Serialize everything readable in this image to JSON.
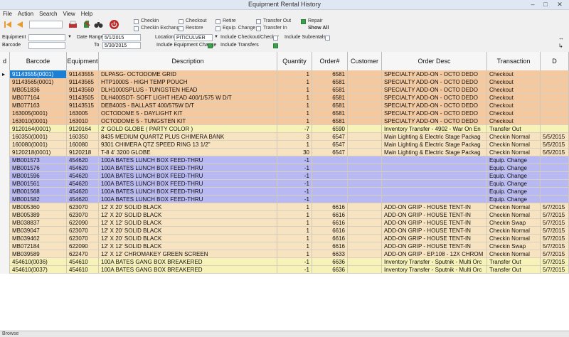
{
  "window": {
    "title": "Equipment Rental History"
  },
  "menu": [
    "File",
    "Action",
    "Search",
    "View",
    "Help"
  ],
  "filters": {
    "equipment_label": "Equipment",
    "equipment_value": "",
    "barcode_label": "Barcode",
    "barcode_value": "",
    "date_range_label": "Date Range",
    "date_from": "5/1/2015",
    "to_label": "To",
    "date_to": "5/30/2015",
    "location_label": "Location",
    "location_value": "PITICULVER",
    "include_equipment_change": "Include Equipment Change",
    "include_checkout_checker": "Include Checkout/Checker",
    "include_subrentals": "Include Subrentals",
    "include_transfers": "Include Transfers"
  },
  "trans_types": [
    {
      "label": "Checkin",
      "checked": false
    },
    {
      "label": "Checkout",
      "checked": false
    },
    {
      "label": "Retire",
      "checked": false
    },
    {
      "label": "Transfer Out",
      "checked": false
    },
    {
      "label": "Repair",
      "checked": true
    },
    {
      "label": "Checkin Exchange",
      "checked": false
    },
    {
      "label": "Restore",
      "checked": false
    },
    {
      "label": "Equip. Change",
      "checked": false
    },
    {
      "label": "Transfer In",
      "checked": false
    },
    {
      "label": "Show All",
      "checked": false
    }
  ],
  "columns": [
    "d",
    "Barcode",
    "Equipment",
    "Description",
    "Quantity",
    "Order#",
    "Customer",
    "Order Desc",
    "Transaction",
    "D"
  ],
  "colors": {
    "checkout": "#f5c9a0",
    "transfer": "#f7f2b8",
    "checkin": "#f7e3bf",
    "equipchange": "#b8b8f2",
    "selected": "#1c7fd6"
  },
  "rows": [
    {
      "barcode": "91143555(0001)",
      "equipment": "91143555",
      "description": "DLPASG- OCTODOME GRID",
      "quantity": "1",
      "order": "6581",
      "customer": "",
      "order_desc": "SPECIALTY ADD-ON - OCTO DEDO",
      "transaction": "Checkout",
      "date": "",
      "type": "checkout",
      "selected": true
    },
    {
      "barcode": "91143565(0001)",
      "equipment": "91143565",
      "description": "HTP1000S - HIGH TEMP POUCH",
      "quantity": "1",
      "order": "6581",
      "customer": "",
      "order_desc": "SPECIALTY ADD-ON - OCTO DEDO",
      "transaction": "Checkout",
      "date": "",
      "type": "checkout"
    },
    {
      "barcode": "MB051836",
      "equipment": "91143560",
      "description": "DLH1000SPLUS - TUNGSTEN HEAD",
      "quantity": "1",
      "order": "6581",
      "customer": "",
      "order_desc": "SPECIALTY ADD-ON - OCTO DEDO",
      "transaction": "Checkout",
      "date": "",
      "type": "checkout"
    },
    {
      "barcode": "MB077164",
      "equipment": "91143505",
      "description": "DLH400SDT- SOFT LIGHT HEAD 400/1/575 W D/T",
      "quantity": "1",
      "order": "6581",
      "customer": "",
      "order_desc": "SPECIALTY ADD-ON - OCTO DEDO",
      "transaction": "Checkout",
      "date": "",
      "type": "checkout"
    },
    {
      "barcode": "MB077163",
      "equipment": "91143515",
      "description": "DEB400S - BALLAST 400/575W D/T",
      "quantity": "1",
      "order": "6581",
      "customer": "",
      "order_desc": "SPECIALTY ADD-ON - OCTO DEDO",
      "transaction": "Checkout",
      "date": "",
      "type": "checkout"
    },
    {
      "barcode": "163005(0001)",
      "equipment": "163005",
      "description": "OCTODOME 5 - DAYLIGHT KIT",
      "quantity": "1",
      "order": "6581",
      "customer": "",
      "order_desc": "SPECIALTY ADD-ON - OCTO DEDO",
      "transaction": "Checkout",
      "date": "",
      "type": "checkout"
    },
    {
      "barcode": "163010(0001)",
      "equipment": "163010",
      "description": "OCTODOME 5 - TUNGSTEN KIT",
      "quantity": "1",
      "order": "6581",
      "customer": "",
      "order_desc": "SPECIALTY ADD-ON - OCTO DEDO",
      "transaction": "Checkout",
      "date": "",
      "type": "checkout"
    },
    {
      "barcode": "9120164(0001)",
      "equipment": "9120164",
      "description": "2' GOLD GLOBE ( PARTY COLOR )",
      "quantity": "-7",
      "order": "6590",
      "customer": "",
      "order_desc": "Inventory Transfer - 4902 - War On En",
      "transaction": "Transfer Out",
      "date": "",
      "type": "transfer"
    },
    {
      "barcode": "160350(0001)",
      "equipment": "160350",
      "description": "8435 MEDIUM QUARTZ PLUS CHIMERA BANK",
      "quantity": "3",
      "order": "6547",
      "customer": "",
      "order_desc": "Main Lighting & Electric Stage Packag",
      "transaction": "Checkin Normal",
      "date": "5/5/2015",
      "type": "checkin"
    },
    {
      "barcode": "160080(0001)",
      "equipment": "160080",
      "description": "9301 CHIMERA QTZ SPEED RING  13 1/2\"",
      "quantity": "1",
      "order": "6547",
      "customer": "",
      "order_desc": "Main Lighting & Electric Stage Packag",
      "transaction": "Checkin Normal",
      "date": "5/5/2015",
      "type": "checkin"
    },
    {
      "barcode": "9120218(0001)",
      "equipment": "9120218",
      "description": "T-8 4' 3200 GLOBE",
      "quantity": "30",
      "order": "6547",
      "customer": "",
      "order_desc": "Main Lighting & Electric Stage Packag",
      "transaction": "Checkin Normal",
      "date": "5/5/2015",
      "type": "checkin"
    },
    {
      "barcode": "MB001573",
      "equipment": "454620",
      "description": "100A BATES LUNCH BOX FEED-THRU",
      "quantity": "-1",
      "order": "",
      "customer": "",
      "order_desc": "",
      "transaction": "Equip. Change",
      "date": "",
      "type": "equipchange"
    },
    {
      "barcode": "MB001576",
      "equipment": "454620",
      "description": "100A BATES LUNCH BOX FEED-THRU",
      "quantity": "-1",
      "order": "",
      "customer": "",
      "order_desc": "",
      "transaction": "Equip. Change",
      "date": "",
      "type": "equipchange"
    },
    {
      "barcode": "MB001596",
      "equipment": "454620",
      "description": "100A BATES LUNCH BOX FEED-THRU",
      "quantity": "-1",
      "order": "",
      "customer": "",
      "order_desc": "",
      "transaction": "Equip. Change",
      "date": "",
      "type": "equipchange"
    },
    {
      "barcode": "MB001561",
      "equipment": "454620",
      "description": "100A BATES LUNCH BOX FEED-THRU",
      "quantity": "-1",
      "order": "",
      "customer": "",
      "order_desc": "",
      "transaction": "Equip. Change",
      "date": "",
      "type": "equipchange"
    },
    {
      "barcode": "MB001568",
      "equipment": "454620",
      "description": "100A BATES LUNCH BOX FEED-THRU",
      "quantity": "-1",
      "order": "",
      "customer": "",
      "order_desc": "",
      "transaction": "Equip. Change",
      "date": "",
      "type": "equipchange"
    },
    {
      "barcode": "MB001582",
      "equipment": "454620",
      "description": "100A BATES LUNCH BOX FEED-THRU",
      "quantity": "-1",
      "order": "",
      "customer": "",
      "order_desc": "",
      "transaction": "Equip. Change",
      "date": "",
      "type": "equipchange"
    },
    {
      "barcode": "MB005360",
      "equipment": "623070",
      "description": "12' X 20' SOLID BLACK",
      "quantity": "1",
      "order": "6616",
      "customer": "",
      "order_desc": "ADD-ON GRIP - HOUSE TENT-IN",
      "transaction": "Checkin Normal",
      "date": "5/7/2015",
      "type": "checkin"
    },
    {
      "barcode": "MB005389",
      "equipment": "623070",
      "description": "12' X 20' SOLID BLACK",
      "quantity": "1",
      "order": "6616",
      "customer": "",
      "order_desc": "ADD-ON GRIP - HOUSE TENT-IN",
      "transaction": "Checkin Normal",
      "date": "5/7/2015",
      "type": "checkin"
    },
    {
      "barcode": "MB038837",
      "equipment": "622090",
      "description": "12' X 12' SOLID BLACK",
      "quantity": "1",
      "order": "6616",
      "customer": "",
      "order_desc": "ADD-ON GRIP - HOUSE TENT-IN",
      "transaction": "Checkin Swap",
      "date": "5/7/2015",
      "type": "checkin"
    },
    {
      "barcode": "MB039047",
      "equipment": "623070",
      "description": "12' X 20' SOLID BLACK",
      "quantity": "1",
      "order": "6616",
      "customer": "",
      "order_desc": "ADD-ON GRIP - HOUSE TENT-IN",
      "transaction": "Checkin Normal",
      "date": "5/7/2015",
      "type": "checkin"
    },
    {
      "barcode": "MB039462",
      "equipment": "623070",
      "description": "12' X 20' SOLID BLACK",
      "quantity": "1",
      "order": "6616",
      "customer": "",
      "order_desc": "ADD-ON GRIP - HOUSE TENT-IN",
      "transaction": "Checkin Normal",
      "date": "5/7/2015",
      "type": "checkin"
    },
    {
      "barcode": "MB072184",
      "equipment": "622090",
      "description": "12' X 12' SOLID BLACK",
      "quantity": "1",
      "order": "6616",
      "customer": "",
      "order_desc": "ADD-ON GRIP - HOUSE TENT-IN",
      "transaction": "Checkin Swap",
      "date": "5/7/2015",
      "type": "checkin"
    },
    {
      "barcode": "MB039589",
      "equipment": "622470",
      "description": "12' X 12' CHROMAKEY GREEN SCREEN",
      "quantity": "1",
      "order": "6633",
      "customer": "",
      "order_desc": "ADD-ON GRIP - EP.108 - 12X CHROM",
      "transaction": "Checkin Normal",
      "date": "5/7/2015",
      "type": "checkin"
    },
    {
      "barcode": "454610(0036)",
      "equipment": "454610",
      "description": "100A BATES GANG BOX BREAKERED",
      "quantity": "-1",
      "order": "6636",
      "customer": "",
      "order_desc": "Inventory Transfer - Sputnik - Multi Orc",
      "transaction": "Transfer Out",
      "date": "5/7/2015",
      "type": "transfer"
    },
    {
      "barcode": "454610(0037)",
      "equipment": "454610",
      "description": "100A BATES GANG BOX BREAKERED",
      "quantity": "-1",
      "order": "6636",
      "customer": "",
      "order_desc": "Inventory Transfer - Sputnik - Multi Orc",
      "transaction": "Transfer Out",
      "date": "5/7/2015",
      "type": "transfer"
    }
  ],
  "status": {
    "text": "Browse"
  }
}
